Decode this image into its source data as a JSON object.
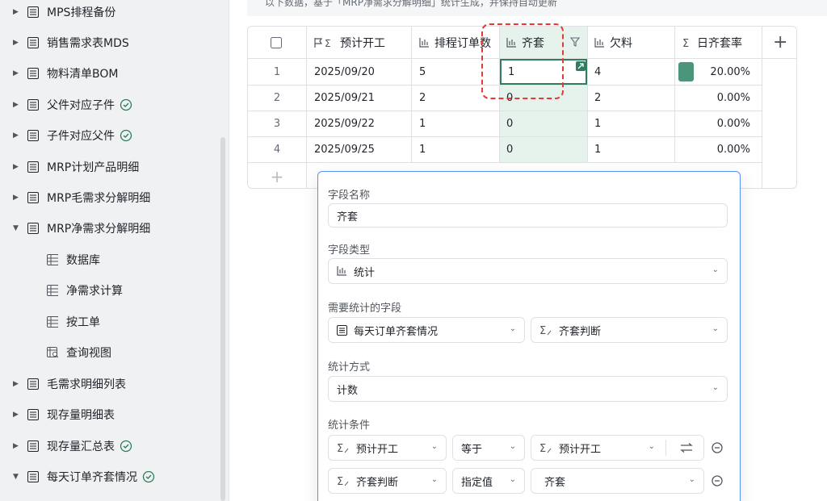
{
  "sidebar": {
    "items": [
      {
        "label": "MPS排程备份",
        "caret": "▶",
        "icon": "table-list-icon",
        "check": false
      },
      {
        "label": "销售需求表MDS",
        "caret": "▶",
        "icon": "table-list-icon",
        "check": false
      },
      {
        "label": "物料清单BOM",
        "caret": "▶",
        "icon": "table-list-icon",
        "check": false
      },
      {
        "label": "父件对应子件",
        "caret": "▶",
        "icon": "table-list-icon",
        "check": true
      },
      {
        "label": "子件对应父件",
        "caret": "▶",
        "icon": "table-list-icon",
        "check": true
      },
      {
        "label": "MRP计划产品明细",
        "caret": "▶",
        "icon": "table-list-icon",
        "check": false
      },
      {
        "label": "MRP毛需求分解明细",
        "caret": "▶",
        "icon": "table-list-icon",
        "check": false
      },
      {
        "label": "MRP净需求分解明细",
        "caret": "▼",
        "icon": "table-list-icon",
        "check": false
      },
      {
        "label": "数据库",
        "caret": "",
        "icon": "grid-view-icon",
        "check": false
      },
      {
        "label": "净需求计算",
        "caret": "",
        "icon": "grid-view-icon",
        "check": false
      },
      {
        "label": "按工单",
        "caret": "",
        "icon": "grid-view-icon",
        "check": false
      },
      {
        "label": "查询视图",
        "caret": "",
        "icon": "query-view-icon",
        "check": false
      },
      {
        "label": "毛需求明细列表",
        "caret": "▶",
        "icon": "table-list-icon",
        "check": false
      },
      {
        "label": "现存量明细表",
        "caret": "▶",
        "icon": "table-list-icon",
        "check": false
      },
      {
        "label": "现存量汇总表",
        "caret": "▶",
        "icon": "table-list-icon",
        "check": true
      },
      {
        "label": "每天订单齐套情况",
        "caret": "▼",
        "icon": "table-list-icon",
        "check": true
      }
    ]
  },
  "topnote": "以下数据，基于「MRP净需求分解明细」统计生成，并保持自动更新",
  "table": {
    "columns": [
      {
        "label": "",
        "icon": "checkbox-icon"
      },
      {
        "label": "预计开工",
        "icon": "formula-flag-icon"
      },
      {
        "label": "排程订单数",
        "icon": "statistics-icon"
      },
      {
        "label": "齐套",
        "icon": "statistics-icon"
      },
      {
        "label": "欠料",
        "icon": "statistics-icon"
      },
      {
        "label": "日齐套率",
        "icon": "sum-icon"
      }
    ],
    "rows": [
      {
        "num": "1",
        "date": "2025/09/20",
        "orders": "5",
        "complete": "1",
        "short": "4",
        "rate": "20.00%"
      },
      {
        "num": "2",
        "date": "2025/09/21",
        "orders": "2",
        "complete": "0",
        "short": "2",
        "rate": "0.00%"
      },
      {
        "num": "3",
        "date": "2025/09/22",
        "orders": "1",
        "complete": "0",
        "short": "1",
        "rate": "0.00%"
      },
      {
        "num": "4",
        "date": "2025/09/25",
        "orders": "1",
        "complete": "0",
        "short": "1",
        "rate": "0.00%"
      }
    ],
    "add_row": "+",
    "add_col": "+"
  },
  "panel": {
    "name_label": "字段名称",
    "name_value": "齐套",
    "type_label": "字段类型",
    "type_value": "统计",
    "stat_field_label": "需要统计的字段",
    "stat_table": "每天订单齐套情况",
    "stat_field": "齐套判断",
    "method_label": "统计方式",
    "method_value": "计数",
    "cond_label": "统计条件",
    "conditions": [
      {
        "field": "预计开工",
        "op": "等于",
        "value": "预计开工"
      },
      {
        "field": "齐套判断",
        "op": "指定值",
        "value": "齐套"
      }
    ]
  },
  "colors": {
    "accent": "#2f7d5c",
    "highlight": "#e6f2ec",
    "dashed": "#e53935",
    "panel_border": "#5b8ff9",
    "rate_bar": "#4b957b"
  }
}
